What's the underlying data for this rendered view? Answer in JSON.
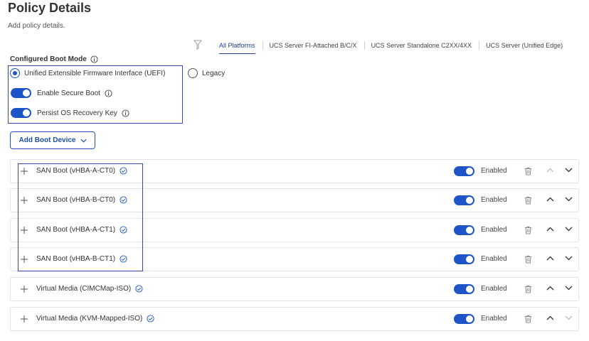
{
  "header": {
    "title": "Policy Details",
    "subtitle": "Add policy details."
  },
  "platform_tabs": [
    {
      "label": "All Platforms",
      "active": true
    },
    {
      "label": "UCS Server FI-Attached B/C/X",
      "active": false
    },
    {
      "label": "UCS Server Standalone C2XX/4XX",
      "active": false
    },
    {
      "label": "UCS Server (Unified Edge)",
      "active": false
    }
  ],
  "boot_mode": {
    "label": "Configured Boot Mode",
    "options": [
      {
        "label": "Unified Extensible Firmware Interface (UEFI)",
        "selected": true
      },
      {
        "label": "Legacy",
        "selected": false
      }
    ],
    "toggles": [
      {
        "label": "Enable Secure Boot",
        "on": true
      },
      {
        "label": "Persist OS Recovery Key",
        "on": true
      }
    ]
  },
  "add_boot_device": {
    "label": "Add Boot Device"
  },
  "boot_devices": [
    {
      "name": "SAN Boot (vHBA-A-CT0)",
      "status": "Enabled"
    },
    {
      "name": "SAN Boot (vHBA-B-CT0)",
      "status": "Enabled"
    },
    {
      "name": "SAN Boot (vHBA-A-CT1)",
      "status": "Enabled"
    },
    {
      "name": "SAN Boot (vHBA-B-CT1)",
      "status": "Enabled"
    },
    {
      "name": "Virtual Media (CIMCMap-ISO)",
      "status": "Enabled"
    },
    {
      "name": "Virtual Media (KVM-Mapped-ISO)",
      "status": "Enabled"
    }
  ],
  "colors": {
    "accent": "#1d55c9",
    "highlight_box": "#3548a8",
    "active_tab": "#1f3f8f"
  }
}
